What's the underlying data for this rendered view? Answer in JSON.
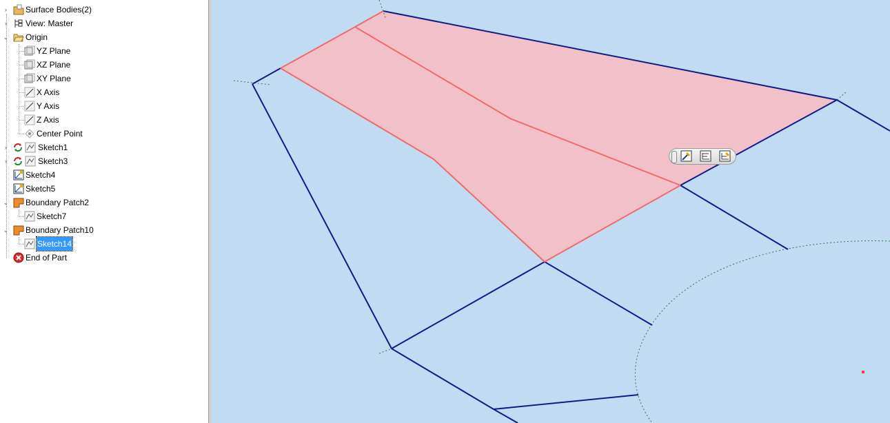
{
  "browser": {
    "items": [
      {
        "label": "Surface Bodies(2)",
        "icon": "surface-bodies-folder-icon",
        "expander": "collapsed"
      },
      {
        "label": "View: Master",
        "icon": "view-rep-icon",
        "expander": "collapsed"
      },
      {
        "label": "Origin",
        "icon": "folder-open-icon",
        "expander": "expanded"
      },
      {
        "label": "YZ Plane",
        "icon": "work-plane-icon"
      },
      {
        "label": "XZ Plane",
        "icon": "work-plane-icon"
      },
      {
        "label": "XY Plane",
        "icon": "work-plane-icon"
      },
      {
        "label": "X Axis",
        "icon": "work-axis-icon"
      },
      {
        "label": "Y Axis",
        "icon": "work-axis-icon"
      },
      {
        "label": "Z Axis",
        "icon": "work-axis-icon"
      },
      {
        "label": "Center Point",
        "icon": "work-point-icon"
      },
      {
        "label": "Sketch1",
        "icon": "sketch-icon",
        "status": "update-required-icon",
        "expander": "collapsed"
      },
      {
        "label": "Sketch3",
        "icon": "sketch-icon",
        "status": "update-required-icon",
        "expander": "collapsed"
      },
      {
        "label": "Sketch4",
        "icon": "3d-sketch-icon"
      },
      {
        "label": "Sketch5",
        "icon": "3d-sketch-icon"
      },
      {
        "label": "Boundary Patch2",
        "icon": "boundary-patch-icon",
        "expander": "expanded"
      },
      {
        "label": "Sketch7",
        "icon": "sketch-icon"
      },
      {
        "label": "Boundary Patch10",
        "icon": "boundary-patch-icon",
        "expander": "expanded"
      },
      {
        "label": "Sketch14",
        "icon": "sketch-icon",
        "selected": true
      },
      {
        "label": "End of Part",
        "icon": "end-of-part-icon"
      }
    ]
  },
  "viewport": {
    "background": "#c1dbf3",
    "edge_color": "#0d1a8a",
    "highlight_edge_color": "#f06a6a",
    "highlight_fill_color": "#f1c0c8",
    "mini_toolbar": {
      "buttons": [
        "edit-sketch-icon",
        "create-sketch-icon",
        "edit-3d-sketch-icon"
      ]
    }
  }
}
